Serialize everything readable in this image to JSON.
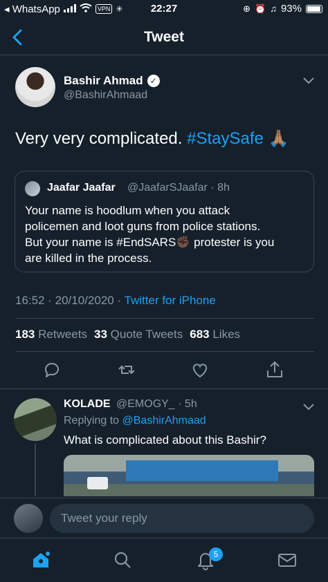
{
  "status_bar": {
    "app": "◂ WhatsApp",
    "vpn": "VPN",
    "time": "22:27",
    "battery": "93%",
    "battery_level": 0.93
  },
  "header": {
    "title": "Tweet",
    "back_icon": "chevron-left-icon"
  },
  "tweet": {
    "author_name": "Bashir Ahmad",
    "author_handle": "@BashirAhmaad",
    "text": "Very very complicated. ",
    "hashtag": "#StaySafe",
    "emoji": "🙏🏽",
    "timestamp": "16:52 · 20/10/2020 · ",
    "source": "Twitter for iPhone",
    "retweets_count": "183",
    "retweets_label": "Retweets",
    "quotes_count": "33",
    "quotes_label": "Quote Tweets",
    "likes_count": "683",
    "likes_label": "Likes"
  },
  "quoted_tweet": {
    "name": "Jaafar Jaafar",
    "handle": "@JaafarSJaafar · 8h",
    "text": "Your name is hoodlum when you attack\npolicemen and loot guns from police stations.\nBut your name is #EndSARS✊🏿 protester is you\nare killed in the process."
  },
  "reply": {
    "name": "KOLADE",
    "handle": "@EMOGY_ · 5h",
    "replying_prefix": "Replying to ",
    "replying_to": "@BashirAhmaad",
    "text": "What is complicated about this Bashir?"
  },
  "reply_bar": {
    "placeholder": "Tweet your reply"
  },
  "tab_bar": {
    "notifications_badge": "5"
  },
  "colors": {
    "background": "#15202b",
    "accent": "#1da1f2",
    "muted": "#8899a6",
    "border": "#38444d"
  }
}
